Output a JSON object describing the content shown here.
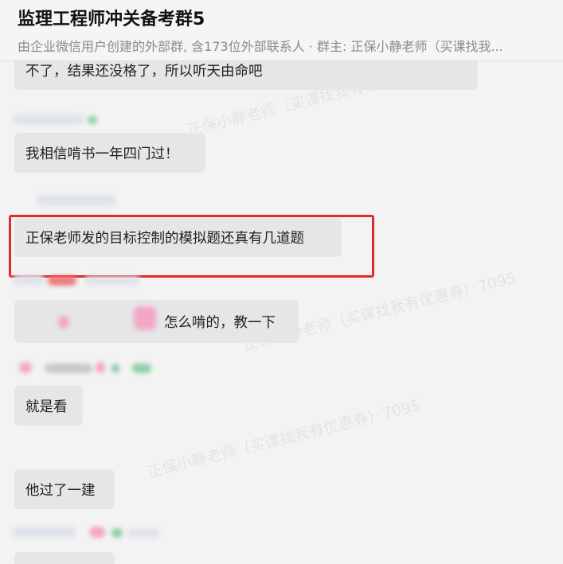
{
  "header": {
    "title": "监理工程师冲关备考群5",
    "subtitle": "由企业微信用户创建的外部群, 含173位外部联系人 · 群主: 正保小静老师（买课找我..."
  },
  "messages": [
    {
      "text": "不了，结果还没格了，所以听天由命吧"
    },
    {
      "text": "我相信啃书一年四门过！"
    },
    {
      "text": "正保老师发的目标控制的模拟题还真有几道题",
      "highlighted": true
    },
    {
      "text": "怎么啃的，教一下"
    },
    {
      "text": "就是看"
    },
    {
      "text": "他过了一建"
    }
  ],
  "watermark": {
    "text": "正保小静老师（买课找我有优惠券）7095"
  },
  "colors": {
    "bubble": "#e6e6e6",
    "highlight_border": "#e12b2b",
    "background": "#f3f3f3"
  }
}
